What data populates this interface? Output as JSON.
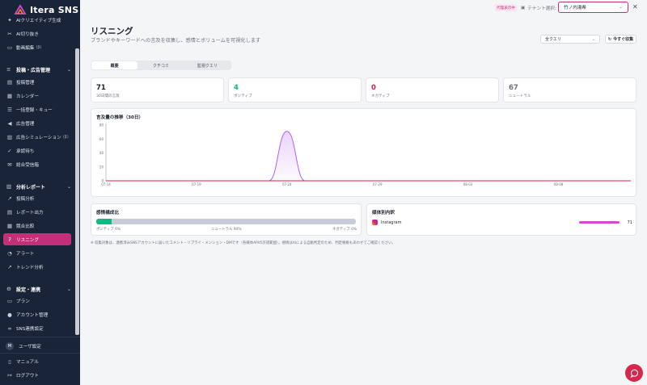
{
  "app": {
    "name": "Itera SNS"
  },
  "sidebar": {
    "top_items": [
      {
        "label": "AIクリエイティブ生成",
        "icon": "sparkle-icon"
      },
      {
        "label": "AI切り抜き",
        "icon": "scissors-icon"
      },
      {
        "label": "動画編集",
        "badge": "(β)",
        "icon": "video-icon"
      }
    ],
    "sections": [
      {
        "label": "投稿・広告管理",
        "items": [
          {
            "label": "投稿管理"
          },
          {
            "label": "カレンダー"
          },
          {
            "label": "一括登録・キュー"
          },
          {
            "label": "広告管理"
          },
          {
            "label": "広告シミュレーション",
            "badge": "(β)"
          },
          {
            "label": "承認待ち"
          },
          {
            "label": "総合受信箱"
          }
        ]
      },
      {
        "label": "分析レポート",
        "items": [
          {
            "label": "投稿分析"
          },
          {
            "label": "レポート出力"
          },
          {
            "label": "競合比較"
          },
          {
            "label": "リスニング"
          },
          {
            "label": "アラート"
          },
          {
            "label": "トレンド分析"
          }
        ]
      },
      {
        "label": "設定・連携",
        "items": [
          {
            "label": "プラン"
          },
          {
            "label": "アカウント管理"
          },
          {
            "label": "SNS連携設定"
          }
        ]
      }
    ],
    "user": {
      "initial": "M",
      "label": "ユーザ設定"
    },
    "manual": "マニュアル",
    "logout": "ログアウト"
  },
  "topbar": {
    "proxy_badge": "代理表示中",
    "tenant_label": "テナント選択:",
    "tenant_value": "竹ノ内湯希"
  },
  "page": {
    "title": "リスニング",
    "subtitle": "ブランドやキーワードへの言及を収集し、感情とボリュームを可視化します",
    "query_select": "全クエリ",
    "collect_button": "今すぐ収集",
    "tabs": [
      "概要",
      "クチコミ",
      "監視クエリ"
    ],
    "active_tab": 0
  },
  "stats": [
    {
      "value": "71",
      "label": "30日間の言及",
      "color": "#1f2330"
    },
    {
      "value": "4",
      "label": "ポジティブ",
      "color": "#10b981"
    },
    {
      "value": "0",
      "label": "ネガティブ",
      "color": "#e11d48"
    },
    {
      "value": "67",
      "label": "ニュートラル",
      "color": "#6b7180"
    }
  ],
  "volume_chart": {
    "title": "言及量の推移（30日）"
  },
  "sentiment": {
    "title": "感情構成比",
    "positive_label": "ポジティブ 6%",
    "neutral_label": "ニュートラル 94%",
    "negative_label": "ネガティブ 0%",
    "positive_fraction": 0.06
  },
  "media": {
    "title": "媒体別内訳",
    "rows": [
      {
        "name": "Instagram",
        "count": "71",
        "fraction": 1.0
      }
    ]
  },
  "footnote": "※ 収集対象は、連携済みSNSアカウントに届いたコメント・リプライ・メンション・DMです（各媒体APIの許諾範囲）。感情はAIによる自動判定のため、判定根拠もあわせてご確認ください。",
  "colors": {
    "accent": "#c2307a",
    "sidebar_bg": "#1a2438",
    "line": "#a855f7",
    "baseline": "#e11d48"
  },
  "chart_data": {
    "type": "line",
    "title": "言及量の推移（30日）",
    "x": [
      "07-14",
      "07-15",
      "07-16",
      "07-17",
      "07-18",
      "07-19",
      "07-20",
      "07-21",
      "07-22",
      "07-23",
      "07-24",
      "07-25",
      "07-26",
      "07-27",
      "07-28",
      "07-29",
      "07-30",
      "07-31",
      "08-01",
      "08-02",
      "08-03",
      "08-04",
      "08-05",
      "08-06",
      "08-07",
      "08-08",
      "08-09",
      "08-10",
      "08-11",
      "08-12"
    ],
    "x_tick_labels": [
      "07-14",
      "07-19",
      "07-24",
      "07-29",
      "08-03",
      "08-08"
    ],
    "series": [
      {
        "values": [
          0,
          0,
          0,
          0,
          0,
          0,
          0,
          0,
          0,
          0,
          71,
          0,
          0,
          0,
          0,
          0,
          0,
          0,
          0,
          0,
          0,
          0,
          0,
          0,
          0,
          0,
          0,
          0,
          0,
          0
        ],
        "color": "#a855f7"
      },
      {
        "values": [
          0,
          0,
          0,
          0,
          0,
          0,
          0,
          0,
          0,
          0,
          0,
          0,
          0,
          0,
          0,
          0,
          0,
          0,
          0,
          0,
          0,
          0,
          0,
          0,
          0,
          0,
          0,
          0,
          0,
          0
        ],
        "color": "#e11d48"
      }
    ],
    "y_ticks": [
      0,
      20,
      40,
      60,
      80
    ],
    "ylim": [
      0,
      80
    ],
    "grid": false
  }
}
